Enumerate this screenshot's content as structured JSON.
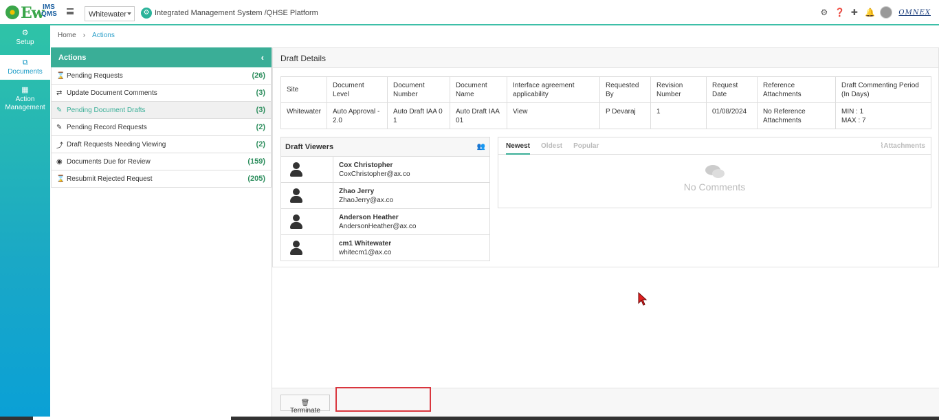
{
  "app": {
    "logo_ew": "Ew",
    "logo_ims": "IMS",
    "logo_qms": "QMS",
    "site": "Whitewater",
    "platform_title": "Integrated Management System /QHSE Platform",
    "brand": "OMNEX"
  },
  "topicons": [
    "gear-icon",
    "help-icon",
    "plus-icon",
    "bell-icon",
    "avatar"
  ],
  "leftnav": {
    "setup": "Setup",
    "documents": "Documents",
    "action_management": "Action Management"
  },
  "breadcrumb": {
    "home": "Home",
    "current": "Actions"
  },
  "actions": {
    "title": "Actions",
    "items": [
      {
        "label": "Pending Requests",
        "count": "(26)",
        "icon": "hourglass-icon"
      },
      {
        "label": "Update Document Comments",
        "count": "(3)",
        "icon": "retweet-icon"
      },
      {
        "label": "Pending Document Drafts",
        "count": "(3)",
        "icon": "edit-icon"
      },
      {
        "label": "Pending Record Requests",
        "count": "(2)",
        "icon": "edit-icon"
      },
      {
        "label": "Draft Requests Needing Viewing",
        "count": "(2)",
        "icon": "share-icon"
      },
      {
        "label": "Documents Due for Review",
        "count": "(159)",
        "icon": "eye-icon"
      },
      {
        "label": "Resubmit Rejected Request",
        "count": "(205)",
        "icon": "hourglass-icon"
      }
    ]
  },
  "draft": {
    "title": "Draft Details",
    "columns": [
      "Site",
      "Document Level",
      "Document Number",
      "Document Name",
      "Interface agreement applicability",
      "Requested By",
      "Revision Number",
      "Request Date",
      "Reference Attachments",
      "Draft Commenting Period (In Days)"
    ],
    "row": {
      "site": "Whitewater",
      "level": "Auto Approval - 2.0",
      "number": "Auto Draft IAA 0 1",
      "name": "Auto Draft IAA 01",
      "interface": "View",
      "requested_by": "P Devaraj",
      "revision": "1",
      "date": "01/08/2024",
      "attachments": "No Reference Attachments",
      "period_min": "MIN : 1",
      "period_max": "MAX : 7"
    }
  },
  "viewers": {
    "title": "Draft Viewers",
    "list": [
      {
        "name": "Cox Christopher",
        "email": "CoxChristopher@ax.co"
      },
      {
        "name": "Zhao Jerry",
        "email": "ZhaoJerry@ax.co"
      },
      {
        "name": "Anderson Heather",
        "email": "AndersonHeather@ax.co"
      },
      {
        "name": "cm1 Whitewater",
        "email": "whitecm1@ax.co"
      }
    ]
  },
  "comments": {
    "tabs": [
      "Newest",
      "Oldest",
      "Popular"
    ],
    "attachments": "Attachments",
    "empty": "No Comments"
  },
  "footer": {
    "terminate": "Terminate"
  }
}
